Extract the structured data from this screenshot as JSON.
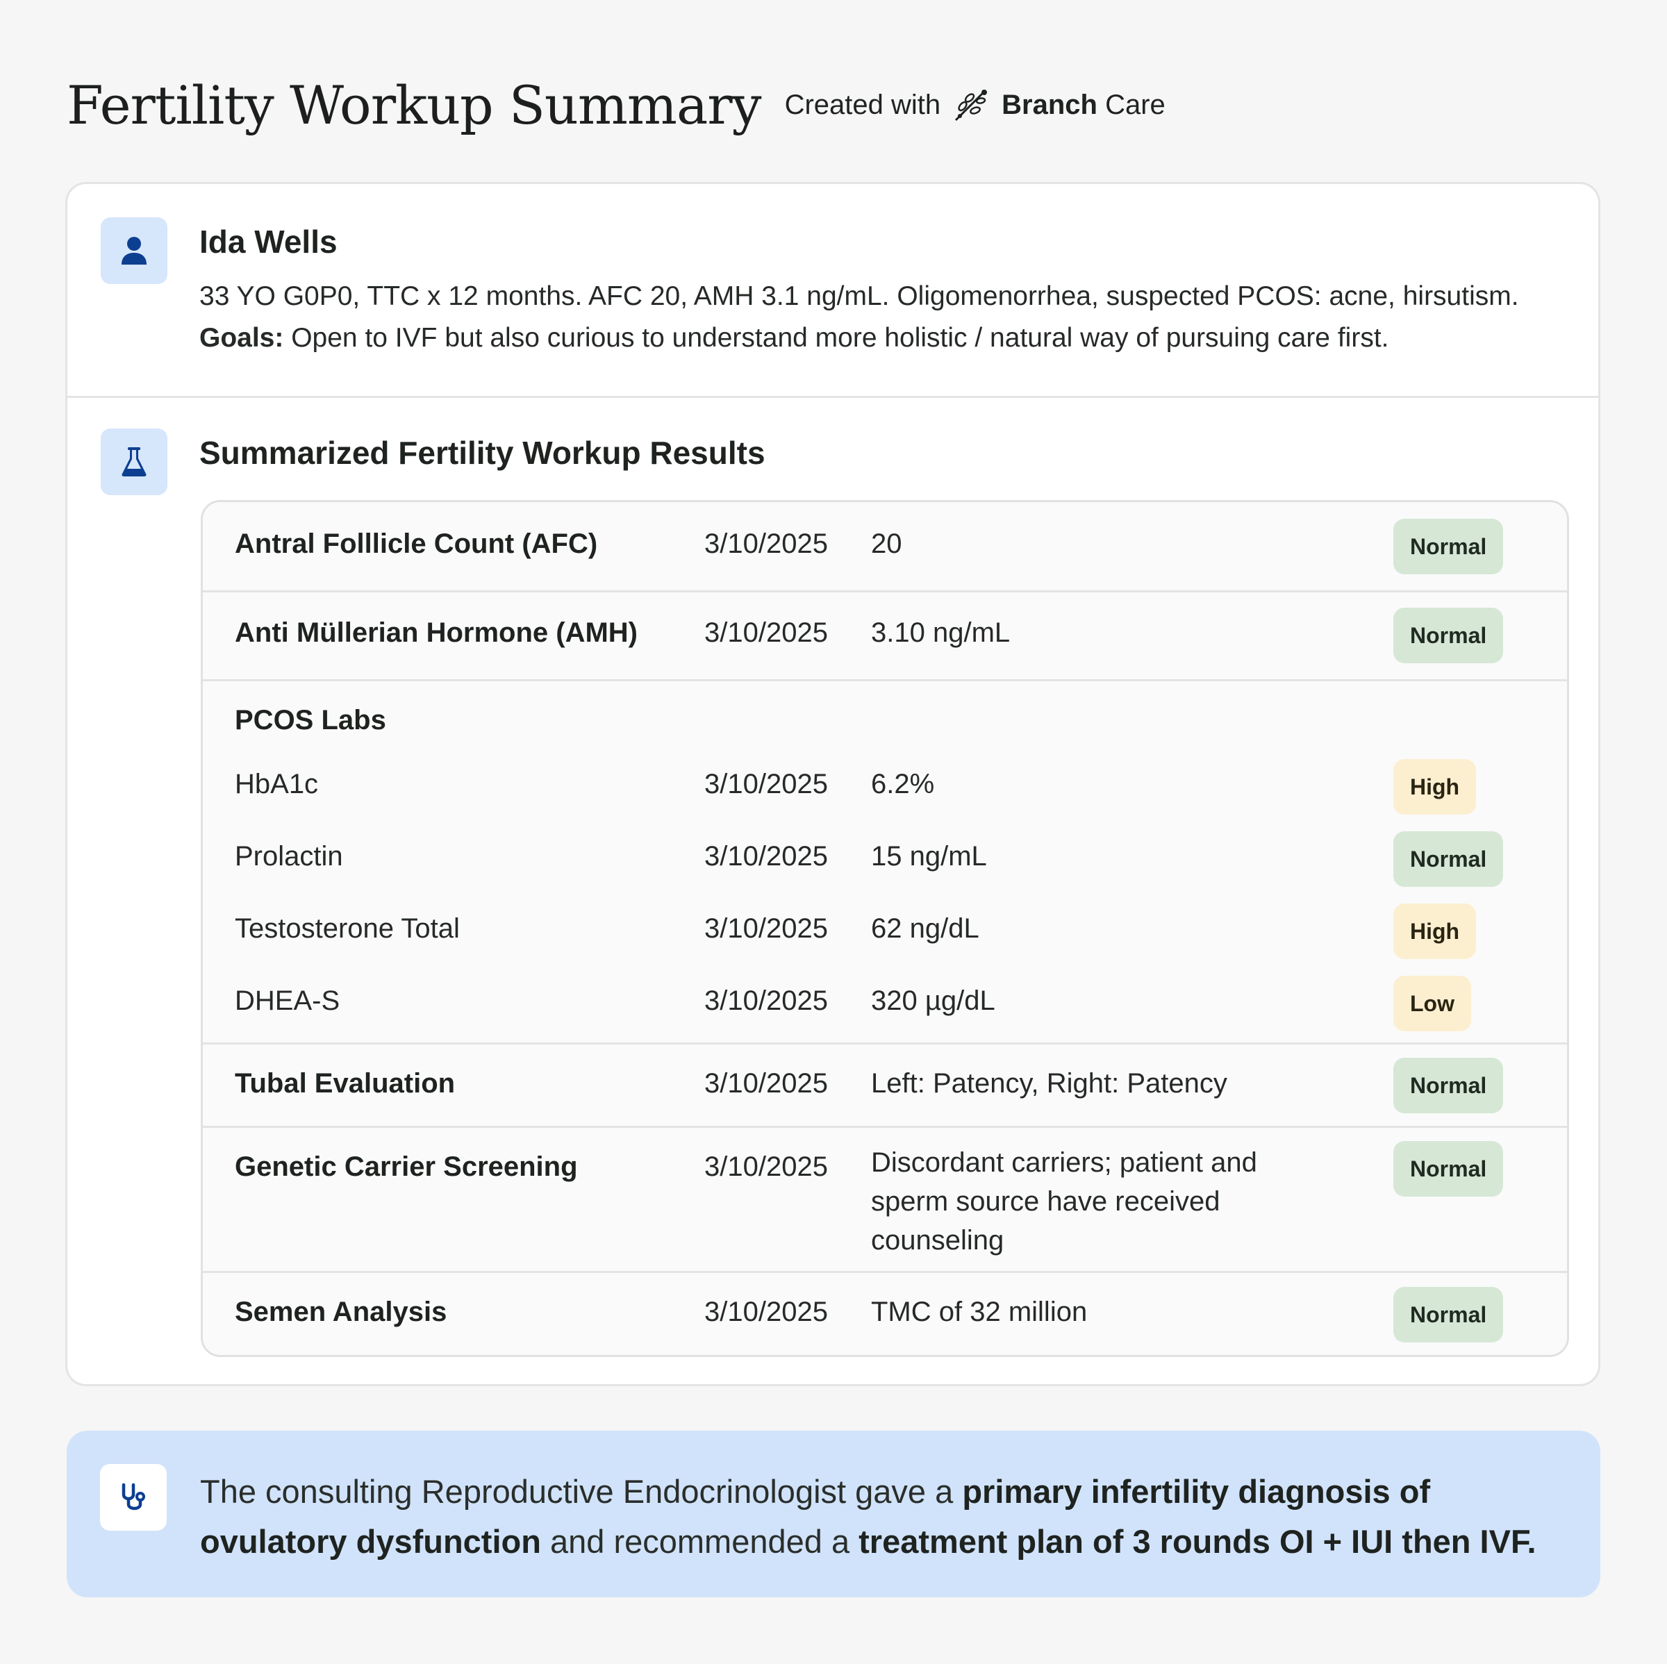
{
  "header": {
    "title": "Fertility Workup Summary",
    "created_with": "Created with",
    "brand_bold": "Branch",
    "brand_light": "Care"
  },
  "patient": {
    "name": "Ida Wells",
    "summary": "33 YO G0P0, TTC x 12 months. AFC 20, AMH 3.1 ng/mL. Oligomenorrhea, suspected PCOS: acne, hirsutism.",
    "goals_label": "Goals:",
    "goals_text": " Open to IVF but also curious to understand more holistic / natural way of pursuing care first."
  },
  "results": {
    "title": "Summarized Fertility Workup Results",
    "afc": {
      "name": "Antral Folllicle Count (AFC)",
      "date": "3/10/2025",
      "value": "20",
      "status": "Normal"
    },
    "amh": {
      "name": "Anti Müllerian Hormone (AMH)",
      "date": "3/10/2025",
      "value": "3.10 ng/mL",
      "status": "Normal"
    },
    "pcos": {
      "label": "PCOS Labs",
      "hba1c": {
        "name": "HbA1c",
        "date": "3/10/2025",
        "value": "6.2%",
        "status": "High"
      },
      "prolactin": {
        "name": "Prolactin",
        "date": "3/10/2025",
        "value": "15 ng/mL",
        "status": "Normal"
      },
      "testosterone": {
        "name": "Testosterone Total",
        "date": "3/10/2025",
        "value": "62 ng/dL",
        "status": "High"
      },
      "dheas": {
        "name": "DHEA-S",
        "date": "3/10/2025",
        "value": "320 µg/dL",
        "status": "Low"
      }
    },
    "tubal": {
      "name": "Tubal Evaluation",
      "date": "3/10/2025",
      "value": "Left: Patency, Right: Patency",
      "status": "Normal"
    },
    "genetic": {
      "name": "Genetic Carrier Screening",
      "date": "3/10/2025",
      "value": "Discordant carriers; patient and sperm source have received counseling",
      "status": "Normal"
    },
    "semen": {
      "name": "Semen Analysis",
      "date": "3/10/2025",
      "value": "TMC of 32 million",
      "status": "Normal"
    }
  },
  "note": {
    "part1": "The consulting Reproductive Endocrinologist gave a ",
    "part2": "primary infertility diagnosis of ovulatory dysfunction",
    "part3": " and recommended a ",
    "part4": "treatment plan of 3 rounds OI + IUI then IVF."
  },
  "colors": {
    "icon_blue": "#0d3f91",
    "icon_bg": "#d6e6fb",
    "normal_badge": "#d6e7d6",
    "high_low_badge": "#fcefd0",
    "note_bg": "#d1e3fa"
  },
  "icons": {
    "patient": "person-icon",
    "results": "flask-icon",
    "note": "stethoscope-icon",
    "brand": "branch-logo"
  }
}
